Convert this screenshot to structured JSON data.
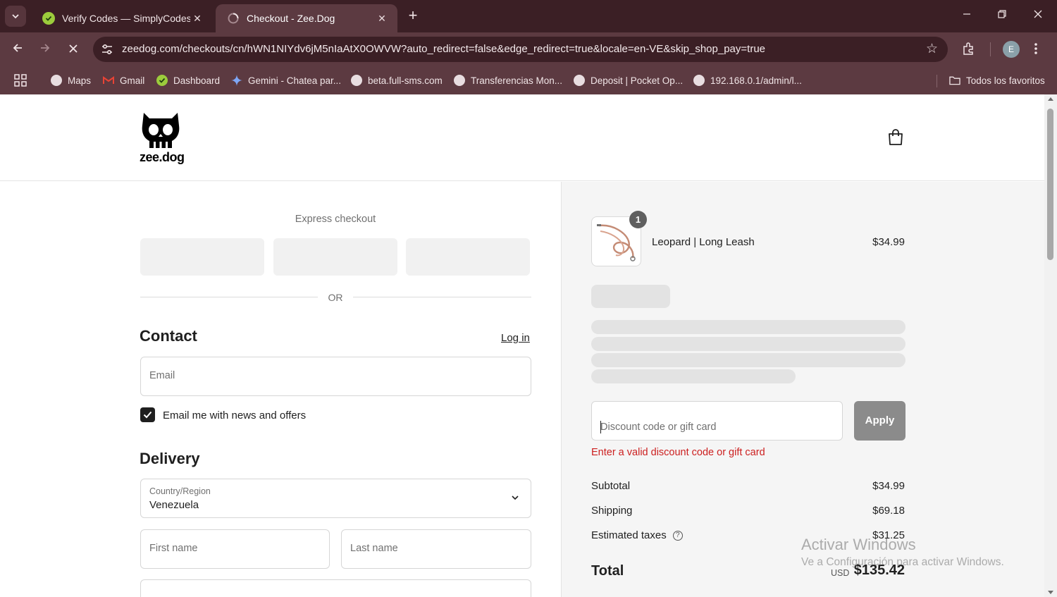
{
  "browser": {
    "tabs": [
      {
        "title": "Verify Codes — SimplyCodes",
        "active": false
      },
      {
        "title": "Checkout - Zee.Dog",
        "active": true
      }
    ],
    "url": "zeedog.com/checkouts/cn/hWN1NIYdv6jM5nIaAtX0OWVW?auto_redirect=false&edge_redirect=true&locale=en-VE&skip_shop_pay=true",
    "profile_initial": "E",
    "bookmarks": [
      "Maps",
      "Gmail",
      "Dashboard",
      "Gemini - Chatea par...",
      "beta.full-sms.com",
      "Transferencias Mon...",
      "Deposit | Pocket Op...",
      "192.168.0.1/admin/l..."
    ],
    "all_bookmarks": "Todos los favoritos",
    "colors": {
      "frame": "#3b1f25",
      "toolbar": "#5c3a41"
    }
  },
  "store": {
    "logo_text": "zee.dog"
  },
  "express": {
    "title": "Express checkout",
    "or": "OR"
  },
  "contact": {
    "title": "Contact",
    "login": "Log in",
    "email_placeholder": "Email",
    "newsletter_label": "Email me with news and offers",
    "newsletter_checked": true
  },
  "delivery": {
    "title": "Delivery",
    "country_label": "Country/Region",
    "country_value": "Venezuela",
    "first_name_placeholder": "First name",
    "last_name_placeholder": "Last name"
  },
  "order": {
    "item": {
      "name": "Leopard | Long Leash",
      "price": "$34.99",
      "quantity": "1"
    },
    "discount_placeholder": "Discount code or gift card",
    "apply": "Apply",
    "error": "Enter a valid discount code or gift card",
    "subtotal_label": "Subtotal",
    "subtotal": "$34.99",
    "shipping_label": "Shipping",
    "shipping": "$69.18",
    "taxes_label": "Estimated taxes",
    "taxes": "$31.25",
    "total_label": "Total",
    "currency": "USD",
    "total": "$135.42",
    "error_color": "#cc1f1f"
  },
  "os": {
    "watermark_title": "Activar Windows",
    "watermark_sub": "Ve a Configuración para activar Windows."
  }
}
